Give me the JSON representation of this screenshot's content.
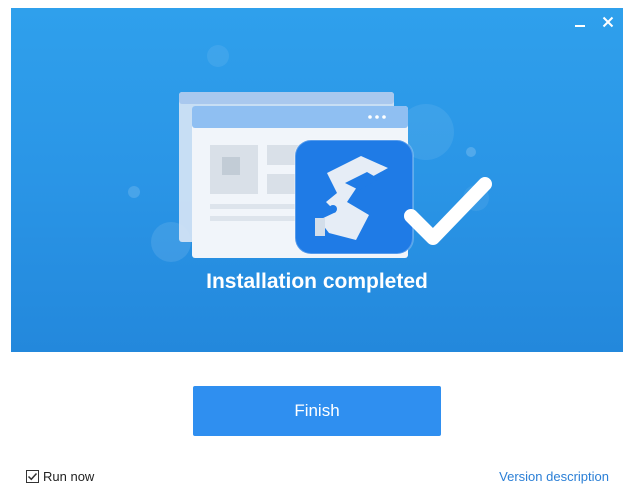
{
  "window": {
    "controls": [
      {
        "name": "minimize",
        "icon": "minimize-icon"
      },
      {
        "name": "close",
        "icon": "close-icon"
      }
    ]
  },
  "hero": {
    "illustration": "installation-complete-illustration",
    "app_logo": "key-logo-icon",
    "check": "checkmark-icon",
    "status_text": "Installation completed"
  },
  "actions": {
    "finish_label": "Finish"
  },
  "footer": {
    "run_now_label": "Run now",
    "run_now_checked": true,
    "version_link": "Version description"
  },
  "colors": {
    "hero_background": "#2a95e6",
    "button": "#2f8ff0",
    "link": "#2b7fd6"
  }
}
